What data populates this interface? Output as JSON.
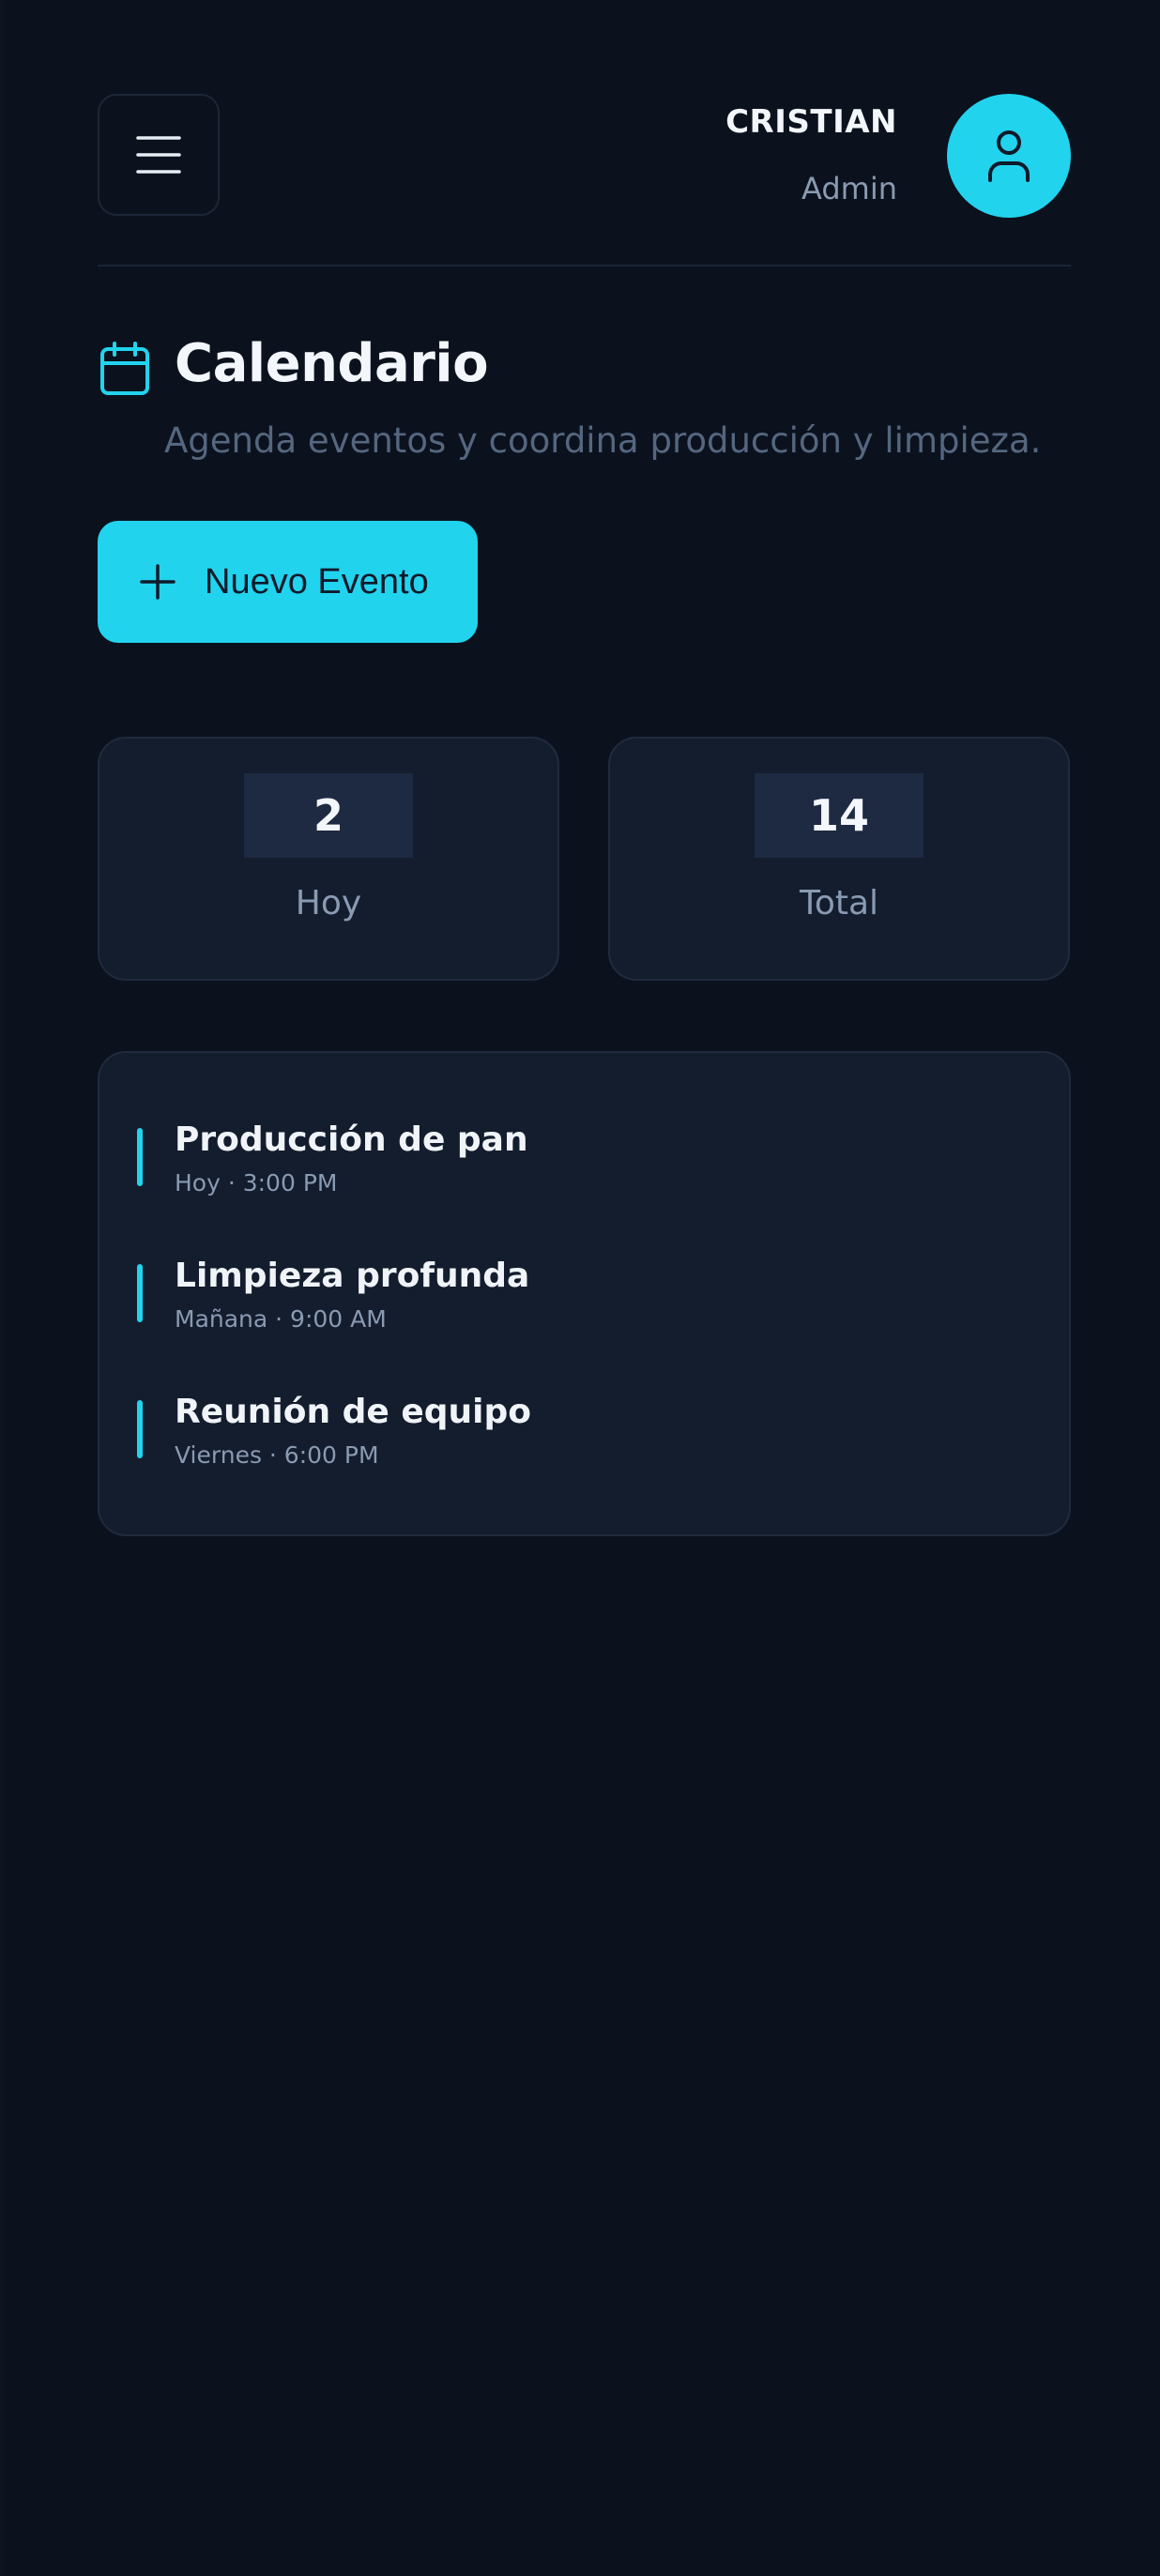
{
  "header": {
    "user_name": "CRISTIAN",
    "user_role": "Admin"
  },
  "page": {
    "title": "Calendario",
    "subtitle": "Agenda eventos y coordina producción y limpieza.",
    "new_event_label": "Nuevo Evento"
  },
  "stats": [
    {
      "value": "2",
      "label": "Hoy"
    },
    {
      "value": "14",
      "label": "Total"
    }
  ],
  "events": [
    {
      "title": "Producción de pan",
      "meta": "Hoy · 3:00 PM"
    },
    {
      "title": "Limpieza profunda",
      "meta": "Mañana · 9:00 AM"
    },
    {
      "title": "Reunión de equipo",
      "meta": "Viernes · 6:00 PM"
    }
  ],
  "colors": {
    "accent": "#22d3ee",
    "background": "#0b121e",
    "card": "#131d2e"
  },
  "icons": [
    "menu-icon",
    "user-icon",
    "calendar-icon",
    "plus-icon"
  ]
}
